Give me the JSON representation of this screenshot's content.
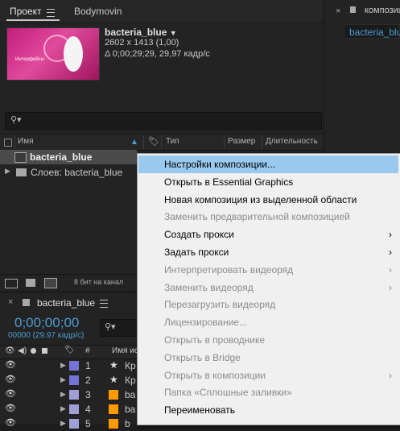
{
  "project": {
    "tabs": [
      "Проект",
      "Bodymovin"
    ],
    "thumb_caption": "Интерфейсы",
    "comp_name": "bacteria_blue",
    "comp_size": "2602 x 1413 (1,00)",
    "comp_duration": "Δ 0;00;29;29, 29,97 кадр/с",
    "columns": [
      "Имя",
      "Тип",
      "Размер",
      "Длительность"
    ],
    "items": [
      {
        "name": "bacteria_blue",
        "selected": true
      },
      {
        "name": "Слоев: bacteria_blue",
        "selected": false
      }
    ],
    "footer_bitdepth": "8 бит на канал"
  },
  "composition_panel": {
    "tab_label": "композици",
    "tab_item": "bacteria_blue"
  },
  "timeline": {
    "tab": "bacteria_blue",
    "timecode": "0;00;00;00",
    "timecode_sub": "00000 (29.97 кадр/с)",
    "col_number": "#",
    "col_source": "Имя ис",
    "layers": [
      {
        "num": "1",
        "color": "#7474d6",
        "type": "star",
        "name": "Кр"
      },
      {
        "num": "2",
        "color": "#7474d6",
        "type": "star",
        "name": "Кр"
      },
      {
        "num": "3",
        "color": "#a0a0d8",
        "type": "ai",
        "name": "ba"
      },
      {
        "num": "4",
        "color": "#a0a0d8",
        "type": "ai",
        "name": "ba"
      },
      {
        "num": "5",
        "color": "#a0a0d8",
        "type": "ai",
        "name": "b"
      }
    ]
  },
  "context_menu": {
    "items": [
      {
        "label": "Настройки композиции...",
        "disabled": false,
        "submenu": false,
        "highlight": true
      },
      {
        "label": "Открыть в Essential Graphics",
        "disabled": false,
        "submenu": false,
        "highlight": false
      },
      {
        "label": "Новая композиция из выделенной области",
        "disabled": false,
        "submenu": false,
        "highlight": false
      },
      {
        "label": "Заменить предварительной композицией",
        "disabled": true,
        "submenu": false,
        "highlight": false
      },
      {
        "label": "Создать прокси",
        "disabled": false,
        "submenu": true,
        "highlight": false
      },
      {
        "label": "Задать прокси",
        "disabled": false,
        "submenu": true,
        "highlight": false
      },
      {
        "label": "Интерпретировать видеоряд",
        "disabled": true,
        "submenu": true,
        "highlight": false
      },
      {
        "label": "Заменить видеоряд",
        "disabled": true,
        "submenu": true,
        "highlight": false
      },
      {
        "label": "Перезагрузить видеоряд",
        "disabled": true,
        "submenu": false,
        "highlight": false
      },
      {
        "label": "Лицензирование...",
        "disabled": true,
        "submenu": false,
        "highlight": false
      },
      {
        "label": "Открыть в проводнике",
        "disabled": true,
        "submenu": false,
        "highlight": false
      },
      {
        "label": "Открыть в Bridge",
        "disabled": true,
        "submenu": false,
        "highlight": false
      },
      {
        "label": "Открыть в композиции",
        "disabled": true,
        "submenu": true,
        "highlight": false
      },
      {
        "label": "Папка «Сплошные заливки»",
        "disabled": true,
        "submenu": false,
        "highlight": false
      },
      {
        "label": "Переименовать",
        "disabled": false,
        "submenu": false,
        "highlight": false
      }
    ]
  },
  "colors": {
    "accent_blue": "#4b9cd3",
    "menu_highlight": "#99c9ef",
    "panel_bg": "#232323"
  }
}
